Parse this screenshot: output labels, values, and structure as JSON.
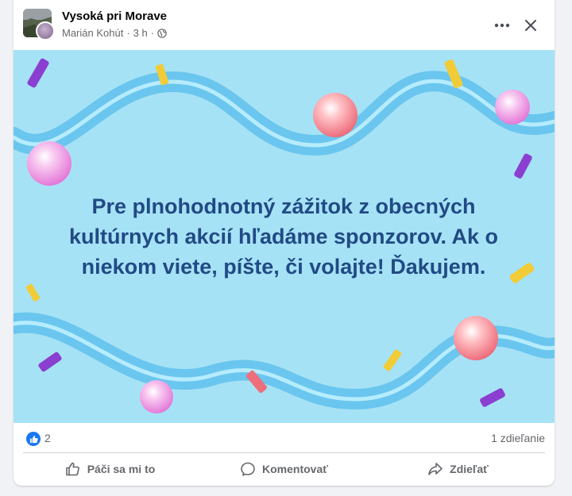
{
  "post": {
    "page_name": "Vysoká pri Morave",
    "author": "Marián Kohút",
    "separator": "·",
    "time": "3 h",
    "privacy_icon": "globe-icon",
    "image_text_lines": [
      "Pre plnohodnotný zážitok z obecných",
      "kultúrnych akcií hľadáme sponzorov. Ak o",
      "niekom viete, píšte, či volajte! Ďakujem."
    ],
    "image_colors": {
      "background": "#a6e2f5",
      "text": "#214a85"
    }
  },
  "header_buttons": {
    "more_icon": "more-dots-icon",
    "close_icon": "close-icon"
  },
  "stats": {
    "reaction_icon": "like-reaction-icon",
    "like_count": "2",
    "shares": "1 zdieľanie"
  },
  "actions": {
    "like_label": "Páči sa mi to",
    "comment_label": "Komentovať",
    "share_label": "Zdieľať"
  },
  "colors": {
    "accent": "#1877f2",
    "secondary_text": "#65676b"
  }
}
